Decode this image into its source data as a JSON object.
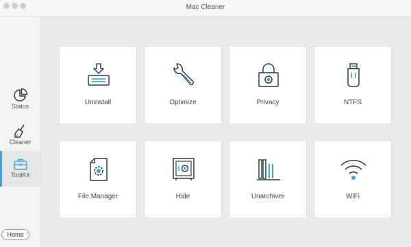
{
  "window": {
    "title": "Mac Cleaner"
  },
  "sidebar": {
    "items": [
      {
        "label": "Status",
        "icon": "pie-chart-icon"
      },
      {
        "label": "Cleaner",
        "icon": "broom-icon"
      },
      {
        "label": "ToolKit",
        "icon": "toolbox-icon",
        "active": true
      }
    ],
    "home_label": "Home"
  },
  "tools": [
    {
      "label": "Uninstall",
      "icon": "uninstall-icon"
    },
    {
      "label": "Optimize",
      "icon": "wrench-icon"
    },
    {
      "label": "Privacy",
      "icon": "lock-icon"
    },
    {
      "label": "NTFS",
      "icon": "usb-drive-icon"
    },
    {
      "label": "File Manager",
      "icon": "file-gear-icon"
    },
    {
      "label": "Hide",
      "icon": "safe-icon"
    },
    {
      "label": "Unarchiver",
      "icon": "archive-icon"
    },
    {
      "label": "WiFi",
      "icon": "wifi-icon"
    }
  ],
  "colors": {
    "accent": "#3ea8dc",
    "icon_stroke": "#2f3e4a"
  }
}
